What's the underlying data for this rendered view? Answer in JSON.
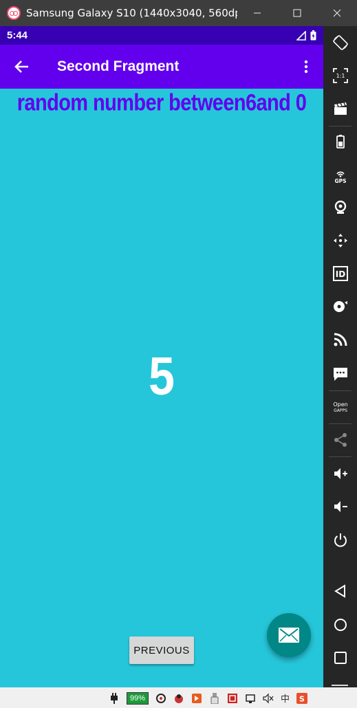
{
  "window": {
    "title": "Samsung Galaxy S10 (1440x3040, 560dp...",
    "controls": [
      "minimize-icon",
      "maximize-icon",
      "close-icon"
    ]
  },
  "statusbar": {
    "time": "5:44",
    "icons": [
      "signal-icon",
      "battery-icon"
    ]
  },
  "appbar": {
    "title": "Second Fragment",
    "back_icon": "arrow-left-icon",
    "menu_icon": "more-vert-icon"
  },
  "content": {
    "heading": "random number between6and 0",
    "number": "5",
    "previous_label": "PREVIOUS",
    "fab_icon": "mail-icon"
  },
  "colors": {
    "background": "#26c6da",
    "appbar": "#6200ee",
    "statusbar": "#3700b3",
    "fab": "#018786",
    "heading": "#6200ee"
  },
  "emulator_toolbar": {
    "items": [
      "rotate-icon",
      "one-to-one-icon",
      "clapper-icon",
      "battery-icon",
      "gps-icon",
      "camera-icon",
      "move-icon",
      "id-icon",
      "disc-icon",
      "rss-icon",
      "message-icon",
      "opengapps-icon",
      "share-icon",
      "volume-up-icon",
      "volume-down-icon",
      "power-icon",
      "nav-back-icon",
      "nav-home-icon",
      "nav-recents-icon"
    ],
    "gps_label": "GPS",
    "id_label": "ID",
    "ratio_label": "1:1",
    "opengapps_label": "Open\nGAPPS"
  },
  "taskbar": {
    "battery_percent": "99%",
    "ime_label": "中",
    "tray_icons": [
      "plug-icon",
      "wifi-icon",
      "app-icon",
      "app-icon-2",
      "usb-icon",
      "shield-icon",
      "network-icon",
      "mute-icon",
      "ime-icon",
      "sogou-icon"
    ]
  }
}
